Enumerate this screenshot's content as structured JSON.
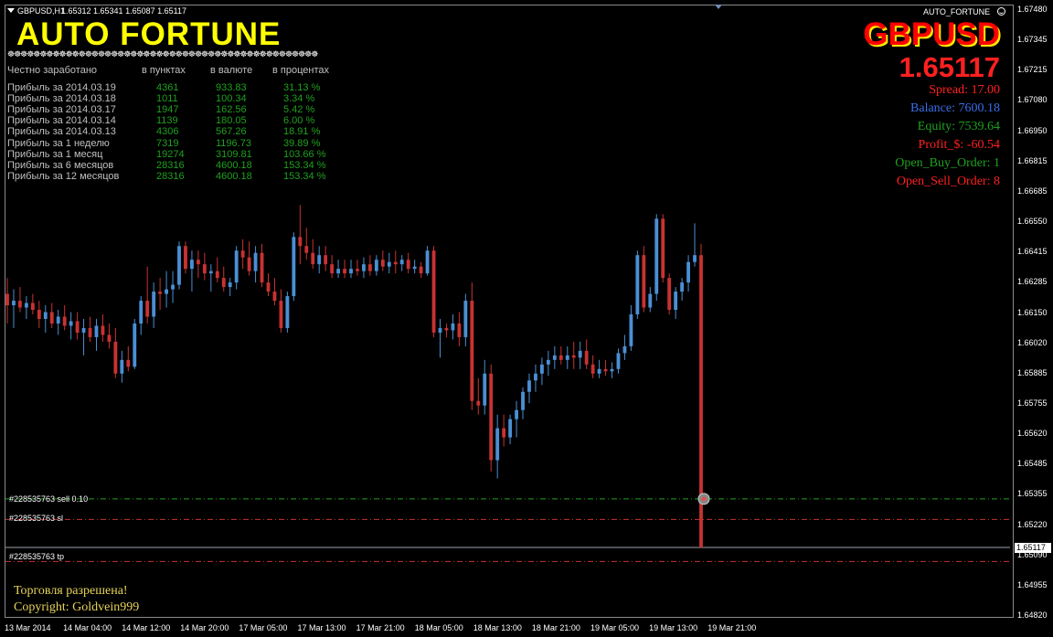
{
  "window": {
    "symbol_header": "GBPUSD,H1",
    "ohlc": "1.65312 1.65341 1.65087 1.65117",
    "ea_name": "AUTO_FORTUNE"
  },
  "brand": "AUTO FORTUNE",
  "wave": "☸☸☸☸☸☸☸☸☸☸☸☸☸☸☸☸☸☸☸☸☸☸☸☸☸☸☸☸☸☸☸☸☸☸☸☸☸☸☸☸☸☸☸☸☸☸☸☸☸☸☸☸☸☸☸☸☸☸",
  "stats": {
    "headers": [
      "Честно заработано",
      "в пунктах",
      "в валюте",
      "в процентах"
    ],
    "rows": [
      {
        "label": "Прибыль за 2014.03.19",
        "points": "4361",
        "money": "933.83",
        "percent": "31.13 %"
      },
      {
        "label": "Прибыль за 2014.03.18",
        "points": "1011",
        "money": "100.34",
        "percent": "3.34 %"
      },
      {
        "label": "Прибыль за 2014.03.17",
        "points": "1947",
        "money": "162.56",
        "percent": "5.42 %"
      },
      {
        "label": "Прибыль за 2014.03.14",
        "points": "1139",
        "money": "180.05",
        "percent": "6.00 %"
      },
      {
        "label": "Прибыль за 2014.03.13",
        "points": "4306",
        "money": "567.26",
        "percent": "18.91 %"
      },
      {
        "label": "Прибыль за 1 неделю",
        "points": "7319",
        "money": "1196.73",
        "percent": "39.89 %"
      },
      {
        "label": "Прибыль за 1 месяц",
        "points": "19274",
        "money": "3109.81",
        "percent": "103.66 %"
      },
      {
        "label": "Прибыль за 6 месяцов",
        "points": "28316",
        "money": "4600.18",
        "percent": "153.34 %"
      },
      {
        "label": "Прибыль за 12 месяцов",
        "points": "28316",
        "money": "4600.18",
        "percent": "153.34 %"
      }
    ]
  },
  "info": {
    "symbol": "GBPUSD",
    "price": "1.65117",
    "lines": [
      {
        "text": "Spread:  17.00",
        "color": "#ff2020"
      },
      {
        "text": "Balance:  7600.18",
        "color": "#3a6ee8"
      },
      {
        "text": "Equity:  7539.64",
        "color": "#1fa01f"
      },
      {
        "text": "Profit_$:  -60.54",
        "color": "#ff2020"
      },
      {
        "text": "Open_Buy_Order:  1",
        "color": "#1fa01f"
      },
      {
        "text": "Open_Sell_Order:  8",
        "color": "#ff2020"
      }
    ]
  },
  "levels": {
    "sell": "#228535763 sell 0.10",
    "sl": "#228535763 sl",
    "tp": "#228535763 tp",
    "current_price": "1.65117"
  },
  "footer": {
    "trade_status": "Торговля разрешена!",
    "copyright": "Copyright:  Goldvein999"
  },
  "chart_data": {
    "type": "candlestick",
    "symbol": "GBPUSD",
    "timeframe": "H1",
    "y_ticks": [
      "1.67480",
      "1.67345",
      "1.67215",
      "1.67080",
      "1.66950",
      "1.66815",
      "1.66685",
      "1.66550",
      "1.66415",
      "1.66285",
      "1.66150",
      "1.66020",
      "1.65885",
      "1.65755",
      "1.65620",
      "1.65485",
      "1.65355",
      "1.65220",
      "1.65090",
      "1.64955",
      "1.64820"
    ],
    "x_ticks": [
      "13 Mar 2014",
      "14 Mar 04:00",
      "14 Mar 12:00",
      "14 Mar 20:00",
      "17 Mar 05:00",
      "17 Mar 13:00",
      "17 Mar 21:00",
      "18 Mar 05:00",
      "18 Mar 13:00",
      "18 Mar 21:00",
      "19 Mar 05:00",
      "19 Mar 13:00",
      "19 Mar 21:00"
    ],
    "ylim": [
      1.6482,
      1.6748
    ],
    "colors": {
      "up": "#4a8fd4",
      "down": "#c83232",
      "sell_line": "#1fa01f",
      "sl_line": "#c83232",
      "tp_line": "#c83232"
    },
    "level_prices": {
      "sell": 1.6533,
      "sl": 1.6524,
      "tp": 1.65055,
      "current": 1.65117
    },
    "candles": [
      [
        1.6623,
        1.663,
        1.661,
        1.6618
      ],
      [
        1.6618,
        1.6625,
        1.6608,
        1.662
      ],
      [
        1.662,
        1.6626,
        1.6615,
        1.6617
      ],
      [
        1.6617,
        1.6622,
        1.6612,
        1.6619
      ],
      [
        1.6619,
        1.6623,
        1.6614,
        1.6616
      ],
      [
        1.6616,
        1.662,
        1.6608,
        1.6612
      ],
      [
        1.6612,
        1.6618,
        1.6606,
        1.6615
      ],
      [
        1.6615,
        1.6619,
        1.6608,
        1.661
      ],
      [
        1.661,
        1.6616,
        1.6605,
        1.6613
      ],
      [
        1.6613,
        1.6618,
        1.6607,
        1.6609
      ],
      [
        1.6609,
        1.6615,
        1.6603,
        1.6611
      ],
      [
        1.6611,
        1.6615,
        1.6603,
        1.6606
      ],
      [
        1.6606,
        1.6612,
        1.6596,
        1.6608
      ],
      [
        1.6608,
        1.6613,
        1.6602,
        1.6604
      ],
      [
        1.6604,
        1.6612,
        1.6598,
        1.6609
      ],
      [
        1.6609,
        1.6614,
        1.6602,
        1.6605
      ],
      [
        1.6605,
        1.661,
        1.6599,
        1.6602
      ],
      [
        1.6602,
        1.6608,
        1.6586,
        1.6588
      ],
      [
        1.6588,
        1.6598,
        1.6584,
        1.6594
      ],
      [
        1.6594,
        1.66,
        1.6589,
        1.6591
      ],
      [
        1.6591,
        1.6612,
        1.659,
        1.661
      ],
      [
        1.661,
        1.6622,
        1.6605,
        1.662
      ],
      [
        1.662,
        1.6635,
        1.661,
        1.6613
      ],
      [
        1.6613,
        1.6628,
        1.6608,
        1.6624
      ],
      [
        1.6624,
        1.663,
        1.6616,
        1.6623
      ],
      [
        1.6623,
        1.6633,
        1.6617,
        1.6625
      ],
      [
        1.6625,
        1.6633,
        1.6619,
        1.6627
      ],
      [
        1.6627,
        1.6646,
        1.6625,
        1.6644
      ],
      [
        1.6644,
        1.6646,
        1.6632,
        1.6634
      ],
      [
        1.6634,
        1.6642,
        1.6624,
        1.6638
      ],
      [
        1.6638,
        1.6642,
        1.663,
        1.6636
      ],
      [
        1.6636,
        1.6641,
        1.6629,
        1.6632
      ],
      [
        1.6632,
        1.6636,
        1.6624,
        1.6633
      ],
      [
        1.6633,
        1.6639,
        1.6628,
        1.663
      ],
      [
        1.663,
        1.6635,
        1.6624,
        1.6626
      ],
      [
        1.6626,
        1.663,
        1.6622,
        1.6628
      ],
      [
        1.6628,
        1.6644,
        1.6625,
        1.6642
      ],
      [
        1.6642,
        1.6647,
        1.6634,
        1.6639
      ],
      [
        1.6639,
        1.6646,
        1.6631,
        1.6633
      ],
      [
        1.6633,
        1.6644,
        1.6628,
        1.6641
      ],
      [
        1.6641,
        1.6645,
        1.6626,
        1.6628
      ],
      [
        1.6628,
        1.6632,
        1.6622,
        1.6624
      ],
      [
        1.6624,
        1.663,
        1.6618,
        1.662
      ],
      [
        1.662,
        1.6625,
        1.6606,
        1.6608
      ],
      [
        1.6608,
        1.6624,
        1.6606,
        1.6622
      ],
      [
        1.6622,
        1.665,
        1.662,
        1.6648
      ],
      [
        1.6648,
        1.6662,
        1.6636,
        1.6644
      ],
      [
        1.6644,
        1.6652,
        1.6638,
        1.6641
      ],
      [
        1.6641,
        1.6647,
        1.6634,
        1.6636
      ],
      [
        1.6636,
        1.6644,
        1.6632,
        1.664
      ],
      [
        1.664,
        1.6644,
        1.6633,
        1.6636
      ],
      [
        1.6636,
        1.664,
        1.663,
        1.6632
      ],
      [
        1.6632,
        1.6638,
        1.663,
        1.6634
      ],
      [
        1.6634,
        1.6638,
        1.663,
        1.6632
      ],
      [
        1.6632,
        1.6638,
        1.663,
        1.6634
      ],
      [
        1.6634,
        1.6638,
        1.6631,
        1.6633
      ],
      [
        1.6633,
        1.6639,
        1.663,
        1.6636
      ],
      [
        1.6636,
        1.664,
        1.6631,
        1.6633
      ],
      [
        1.6633,
        1.664,
        1.6631,
        1.6638
      ],
      [
        1.6638,
        1.6642,
        1.6633,
        1.6635
      ],
      [
        1.6635,
        1.6641,
        1.6632,
        1.6637
      ],
      [
        1.6637,
        1.6642,
        1.6632,
        1.6636
      ],
      [
        1.6636,
        1.664,
        1.6633,
        1.6638
      ],
      [
        1.6638,
        1.6641,
        1.6632,
        1.6634
      ],
      [
        1.6634,
        1.6638,
        1.6632,
        1.6635
      ],
      [
        1.6635,
        1.6637,
        1.663,
        1.6632
      ],
      [
        1.6632,
        1.6644,
        1.6631,
        1.6642
      ],
      [
        1.6642,
        1.6644,
        1.6604,
        1.6606
      ],
      [
        1.6606,
        1.6612,
        1.6595,
        1.6608
      ],
      [
        1.6608,
        1.661,
        1.6604,
        1.6607
      ],
      [
        1.6607,
        1.6614,
        1.6603,
        1.661
      ],
      [
        1.661,
        1.6615,
        1.66,
        1.6604
      ],
      [
        1.6604,
        1.6623,
        1.66,
        1.662
      ],
      [
        1.662,
        1.6628,
        1.6572,
        1.6576
      ],
      [
        1.6576,
        1.6586,
        1.657,
        1.6574
      ],
      [
        1.6574,
        1.6594,
        1.657,
        1.6588
      ],
      [
        1.6588,
        1.6592,
        1.6545,
        1.655
      ],
      [
        1.655,
        1.657,
        1.6542,
        1.6564
      ],
      [
        1.6564,
        1.657,
        1.6556,
        1.656
      ],
      [
        1.656,
        1.657,
        1.6557,
        1.6568
      ],
      [
        1.6568,
        1.6576,
        1.656,
        1.6572
      ],
      [
        1.6572,
        1.6582,
        1.6568,
        1.658
      ],
      [
        1.658,
        1.6588,
        1.6575,
        1.6585
      ],
      [
        1.6585,
        1.6592,
        1.658,
        1.6588
      ],
      [
        1.6588,
        1.6595,
        1.6583,
        1.6592
      ],
      [
        1.6592,
        1.6598,
        1.6587,
        1.6594
      ],
      [
        1.6594,
        1.66,
        1.659,
        1.6596
      ],
      [
        1.6596,
        1.66,
        1.6592,
        1.6594
      ],
      [
        1.6594,
        1.66,
        1.659,
        1.6596
      ],
      [
        1.6596,
        1.6602,
        1.659,
        1.6595
      ],
      [
        1.6595,
        1.6602,
        1.659,
        1.6598
      ],
      [
        1.6598,
        1.6603,
        1.659,
        1.6592
      ],
      [
        1.6592,
        1.6596,
        1.6586,
        1.6588
      ],
      [
        1.6588,
        1.6594,
        1.6586,
        1.659
      ],
      [
        1.659,
        1.6594,
        1.6587,
        1.6589
      ],
      [
        1.6589,
        1.6593,
        1.6586,
        1.659
      ],
      [
        1.659,
        1.6599,
        1.6588,
        1.6597
      ],
      [
        1.6597,
        1.6605,
        1.6594,
        1.66
      ],
      [
        1.66,
        1.6618,
        1.6598,
        1.6614
      ],
      [
        1.6614,
        1.6642,
        1.6612,
        1.664
      ],
      [
        1.664,
        1.6644,
        1.6615,
        1.6617
      ],
      [
        1.6617,
        1.6626,
        1.6615,
        1.6623
      ],
      [
        1.6623,
        1.6658,
        1.662,
        1.6656
      ],
      [
        1.6656,
        1.6658,
        1.6628,
        1.663
      ],
      [
        1.663,
        1.6632,
        1.6614,
        1.6616
      ],
      [
        1.6616,
        1.6626,
        1.6612,
        1.6624
      ],
      [
        1.6624,
        1.663,
        1.662,
        1.6628
      ],
      [
        1.6628,
        1.664,
        1.6624,
        1.6637
      ],
      [
        1.6637,
        1.6654,
        1.6635,
        1.664
      ],
      [
        1.664,
        1.6645,
        1.654,
        1.65117
      ]
    ]
  }
}
